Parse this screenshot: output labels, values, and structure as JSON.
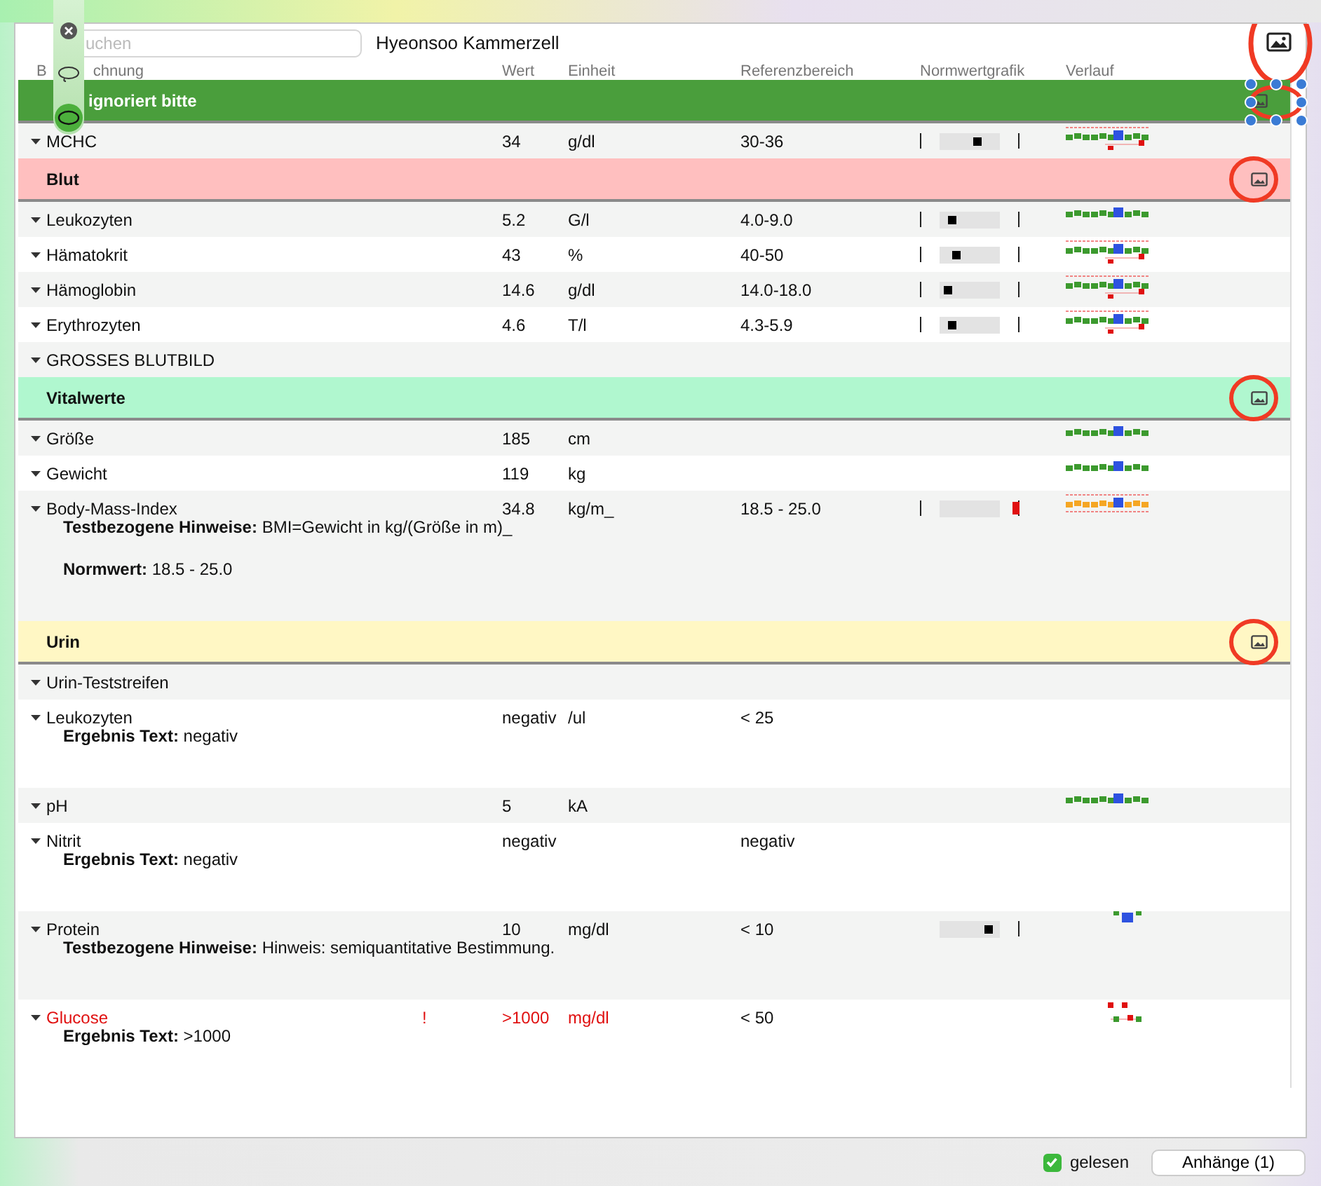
{
  "popover": {
    "tools": [
      {
        "kind": "close",
        "selected": false
      },
      {
        "kind": "lasso",
        "selected": false
      },
      {
        "kind": "ellipse",
        "selected": true
      }
    ]
  },
  "search": {
    "placeholder": "uchen"
  },
  "patient": "Hyeonsoo Kammerzell",
  "header_marked": true,
  "columns": [
    {
      "label_parts": [
        "B",
        "chnung"
      ]
    },
    {
      "label_parts": [
        "Wert"
      ]
    },
    {
      "label_parts": [
        "Einheit"
      ]
    },
    {
      "label_parts": [
        "Referenzbereich"
      ]
    },
    {
      "label_parts": [
        "Normwertgrafik"
      ]
    },
    {
      "label_parts": [
        "Verlauf"
      ]
    }
  ],
  "groups": [
    {
      "title": "ignoriert bitte",
      "color": "#4a9e3c",
      "marked": true,
      "marked_selected": true,
      "rows": [
        {
          "name": "MCHC",
          "value": "34",
          "unit": "g/dl",
          "range": "30-36",
          "alarm": false,
          "norm": {
            "level": 0.65,
            "left_tick": true,
            "out": false
          },
          "sparkline": {
            "kind": "full"
          }
        }
      ]
    },
    {
      "title": "Blut",
      "color": "#ffbfbf",
      "marked": true,
      "marked_selected": false,
      "rows": [
        {
          "name": "Leukozyten",
          "value": "5.2",
          "unit": "G/l",
          "range": "4.0-9.0",
          "alarm": false,
          "norm": {
            "level": 0.12,
            "left_tick": true,
            "out": false
          },
          "sparkline": {
            "kind": "plain"
          }
        },
        {
          "name": "Hämatokrit",
          "value": "43",
          "unit": "%",
          "range": "40-50",
          "alarm": false,
          "norm": {
            "level": 0.22,
            "left_tick": true,
            "out": false
          },
          "sparkline": {
            "kind": "full"
          }
        },
        {
          "name": "Hämoglobin",
          "value": "14.6",
          "unit": "g/dl",
          "range": "14.0-18.0",
          "alarm": false,
          "norm": {
            "level": 0.05,
            "left_tick": true,
            "out": false
          },
          "sparkline": {
            "kind": "full"
          }
        },
        {
          "name": "Erythrozyten",
          "value": "4.6",
          "unit": "T/l",
          "range": "4.3-5.9",
          "alarm": false,
          "norm": {
            "level": 0.12,
            "left_tick": true,
            "out": false
          },
          "sparkline": {
            "kind": "full"
          }
        },
        {
          "name": "GROSSES BLUTBILD",
          "alarm": false
        }
      ]
    },
    {
      "title": "Vitalwerte",
      "color": "#b0f7cf",
      "marked": true,
      "marked_selected": false,
      "rows": [
        {
          "name": "Größe",
          "value": "185",
          "unit": "cm",
          "alarm": false,
          "sparkline": {
            "kind": "plain"
          }
        },
        {
          "name": "Gewicht",
          "value": "119",
          "unit": "kg",
          "alarm": false,
          "sparkline": {
            "kind": "plain"
          }
        },
        {
          "name": "Body-Mass-Index",
          "value": "34.8",
          "unit": "kg/m_",
          "range": "18.5 - 25.0",
          "alarm": false,
          "norm": {
            "left_tick": true,
            "out": true
          },
          "sparkline": {
            "kind": "band"
          },
          "notes": [
            {
              "label": "Testbezogene Hinweise:",
              "text": "BMI=Gewicht in kg/(Größe in m)_"
            },
            {
              "label": "Normwert:",
              "text": "18.5 - 25.0"
            }
          ]
        }
      ]
    },
    {
      "title": "Urin",
      "color": "#fff7c4",
      "marked": true,
      "marked_selected": false,
      "rows": [
        {
          "name": "Urin-Teststreifen",
          "alarm": false
        },
        {
          "name": "Leukozyten",
          "value": "negativ",
          "unit": "/ul",
          "range": "< 25",
          "alarm": false,
          "notes": [
            {
              "label": "Ergebnis Text:",
              "text": "negativ"
            }
          ]
        },
        {
          "name": "pH",
          "value": "5",
          "unit": "kA",
          "alarm": false,
          "sparkline": {
            "kind": "plain"
          }
        },
        {
          "name": "Nitrit",
          "value": "negativ",
          "range": "negativ",
          "alarm": false,
          "notes": [
            {
              "label": "Ergebnis Text:",
              "text": "negativ"
            }
          ]
        },
        {
          "name": "Protein",
          "value": "10",
          "unit": "mg/dl",
          "range": "< 10",
          "alarm": false,
          "norm": {
            "level": 0.9,
            "left_tick": false,
            "out": false
          },
          "sparkline": {
            "kind": "top"
          },
          "notes": [
            {
              "label": "Testbezogene Hinweise:",
              "text": "Hinweis: semiquantitative Bestimmung."
            }
          ]
        },
        {
          "name": "Glucose",
          "flag": "!",
          "value": ">1000",
          "unit": "mg/dl",
          "range": "< 50",
          "alarm": true,
          "sparkline": {
            "kind": "sparse"
          },
          "notes": [
            {
              "label": "Ergebnis Text:",
              "text": ">1000"
            }
          ]
        }
      ]
    }
  ],
  "read": {
    "label": "gelesen",
    "checked": true
  },
  "attachments_button": "Anhänge (1)"
}
